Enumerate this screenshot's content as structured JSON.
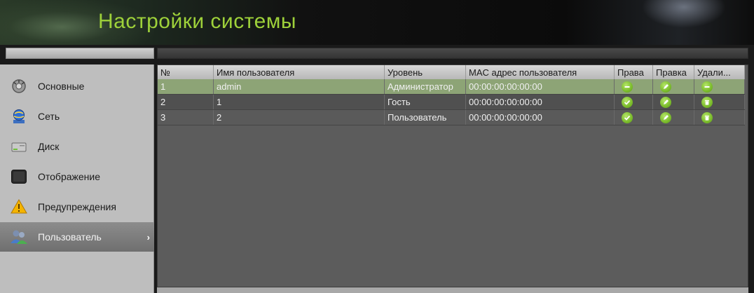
{
  "header": {
    "title": "Настройки системы"
  },
  "sidebar": {
    "items": [
      {
        "label": "Основные",
        "icon": "settings-icon"
      },
      {
        "label": "Сеть",
        "icon": "network-globe-icon"
      },
      {
        "label": "Диск",
        "icon": "disk-drive-icon"
      },
      {
        "label": "Отображение",
        "icon": "monitor-icon"
      },
      {
        "label": "Предупреждения",
        "icon": "warning-icon"
      },
      {
        "label": "Пользователь",
        "icon": "users-icon",
        "active": true,
        "chevron": "›"
      }
    ]
  },
  "table": {
    "headers": {
      "no": "№",
      "name": "Имя пользователя",
      "level": "Уровень",
      "mac": "MAC адрес пользователя",
      "rights": "Права",
      "edit": "Правка",
      "delete": "Удали..."
    },
    "rows": [
      {
        "no": "1",
        "name": "admin",
        "level": "Администратор",
        "mac": "00:00:00:00:00:00",
        "rights_icon": "minus-icon",
        "edit_icon": "pencil-icon",
        "delete_icon": "minus-icon",
        "selected": true
      },
      {
        "no": "2",
        "name": "1",
        "level": "Гость",
        "mac": "00:00:00:00:00:00",
        "rights_icon": "check-icon",
        "edit_icon": "pencil-icon",
        "delete_icon": "trash-icon"
      },
      {
        "no": "3",
        "name": "2",
        "level": "Пользователь",
        "mac": "00:00:00:00:00:00",
        "rights_icon": "check-icon",
        "edit_icon": "pencil-icon",
        "delete_icon": "trash-icon"
      }
    ]
  },
  "colors": {
    "title": "#9ed13a",
    "selected_row": "#8da476",
    "badge": "#7fbf2f"
  }
}
